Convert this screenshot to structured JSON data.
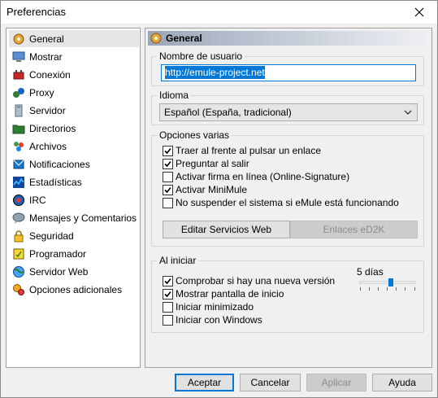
{
  "window": {
    "title": "Preferencias"
  },
  "sidebar": {
    "items": [
      {
        "label": "General",
        "icon": "gear-icon"
      },
      {
        "label": "Mostrar",
        "icon": "monitor-icon"
      },
      {
        "label": "Conexión",
        "icon": "connection-icon"
      },
      {
        "label": "Proxy",
        "icon": "proxy-icon"
      },
      {
        "label": "Servidor",
        "icon": "server-icon"
      },
      {
        "label": "Directorios",
        "icon": "folder-icon"
      },
      {
        "label": "Archivos",
        "icon": "files-icon"
      },
      {
        "label": "Notificaciones",
        "icon": "notification-icon"
      },
      {
        "label": "Estadísticas",
        "icon": "statistics-icon"
      },
      {
        "label": "IRC",
        "icon": "irc-icon"
      },
      {
        "label": "Mensajes y Comentarios",
        "icon": "messages-icon"
      },
      {
        "label": "Seguridad",
        "icon": "lock-icon"
      },
      {
        "label": "Programador",
        "icon": "scheduler-icon"
      },
      {
        "label": "Servidor Web",
        "icon": "globe-icon"
      },
      {
        "label": "Opciones adicionales",
        "icon": "tweaks-icon"
      }
    ],
    "selected": "General"
  },
  "panel": {
    "title": "General",
    "username": {
      "legend": "Nombre de usuario",
      "value": "http://emule-project.net"
    },
    "language": {
      "legend": "Idioma",
      "selected": "Español (España, tradicional)"
    },
    "misc": {
      "legend": "Opciones varias",
      "options": [
        {
          "label": "Traer al frente al pulsar un enlace",
          "checked": true
        },
        {
          "label": "Preguntar al salir",
          "checked": true
        },
        {
          "label": "Activar firma en línea (Online-Signature)",
          "checked": false
        },
        {
          "label": "Activar MiniMule",
          "checked": true
        },
        {
          "label": "No suspender el sistema si eMule está funcionando",
          "checked": false
        }
      ],
      "edit_web_services": "Editar Servicios Web",
      "ed2k_links": "Enlaces eD2K"
    },
    "startup": {
      "legend": "Al iniciar",
      "options": [
        {
          "label": "Comprobar si hay una nueva versión",
          "checked": true
        },
        {
          "label": "Mostrar pantalla de inicio",
          "checked": true
        },
        {
          "label": "Iniciar minimizado",
          "checked": false
        },
        {
          "label": "Iniciar con Windows",
          "checked": false
        }
      ],
      "days_label": "5 días",
      "slider_fraction": 0.56
    }
  },
  "footer": {
    "accept": "Aceptar",
    "cancel": "Cancelar",
    "apply": "Aplicar",
    "help": "Ayuda"
  },
  "colors": {
    "accent": "#0078d7",
    "header_gradient_start": "#9aa6b8"
  }
}
